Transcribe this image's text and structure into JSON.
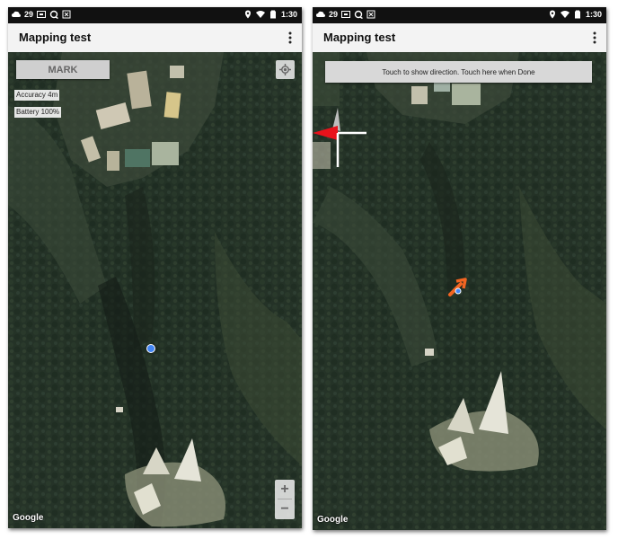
{
  "status_bar": {
    "notification_count": "29",
    "time": "1:30"
  },
  "app_title": "Mapping test",
  "left_screen": {
    "mark_button": "MARK",
    "accuracy": "Accuracy 4m",
    "battery": "Battery 100%",
    "zoom_in": "+",
    "zoom_out": "−",
    "map_attribution": "Google"
  },
  "right_screen": {
    "direction_banner": "Touch to show direction. Touch here when Done",
    "map_attribution": "Google"
  },
  "colors": {
    "location_dot": "#4285f4",
    "compass_north": "#e8121b",
    "orientation_arrow": "#f26522"
  }
}
